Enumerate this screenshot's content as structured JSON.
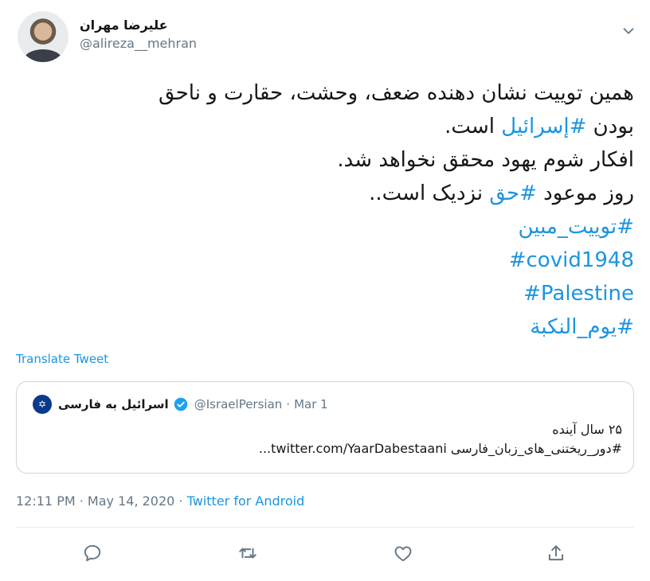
{
  "user": {
    "display_name": "علیرضا مهران",
    "handle": "@alireza__mehran"
  },
  "tweet": {
    "lines": [
      "همین توییت نشان دهنده ضعف، وحشت، حقارت و ناحق",
      "بودن ",
      "#إسرائيل",
      " است.",
      "افکار شوم یهود محقق نخواهد شد.",
      "روز موعود ",
      "#حق",
      " نزدیک است..",
      "#توییت_مبین",
      "#covid1948",
      "#Palestine",
      "#یوم_النکبة"
    ]
  },
  "translate_label": "Translate Tweet",
  "quote": {
    "name": "اسرائیل به فارسی",
    "handle": "@IsraelPersian",
    "separator": "·",
    "date": "Mar 1",
    "avatar_glyph": "✡",
    "line1": "۲۵ سال آینده",
    "line2_tag": "#دور_ریختنی_های_زبان_فارسی",
    "line2_link": " twitter.com/YaarDabestaani..."
  },
  "meta": {
    "time": "12:11 PM",
    "sep1": " · ",
    "date": "May 14, 2020",
    "sep2": " · ",
    "app": "Twitter for Android"
  },
  "icons": {
    "more": "chevron-down-icon",
    "reply": "reply-icon",
    "retweet": "retweet-icon",
    "like": "heart-icon",
    "share": "share-icon"
  },
  "colors": {
    "link": "#1b95e0",
    "secondary_text": "#657786",
    "border": "#ccd6dd"
  }
}
